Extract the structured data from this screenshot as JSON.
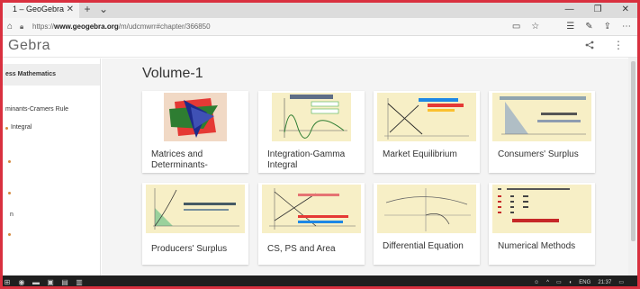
{
  "browser": {
    "tab": {
      "title": "1 – GeoGebra"
    },
    "url_prefix": "https://",
    "url_domain": "www.geogebra.org",
    "url_path": "/m/udcmwrr#chapter/366850"
  },
  "app": {
    "logo": "Gebra"
  },
  "sidebar": {
    "items": [
      {
        "label": "ess Mathematics"
      },
      {
        "label": "minants-Cramers Rule"
      },
      {
        "label": "Integral"
      },
      {
        "label": "n"
      }
    ]
  },
  "main": {
    "title": "Volume-1",
    "cards": [
      {
        "label": "Matrices and Determinants-"
      },
      {
        "label": "Integration-Gamma Integral"
      },
      {
        "label": "Market Equilibrium"
      },
      {
        "label": "Consumers' Surplus"
      },
      {
        "label": "Producers' Surplus"
      },
      {
        "label": "CS, PS and Area"
      },
      {
        "label": "Differential Equation"
      },
      {
        "label": "Numerical Methods"
      }
    ]
  },
  "taskbar": {
    "lang": "ENG",
    "time": "21:37"
  },
  "colors": {
    "frame": "#d9303f",
    "accent_orange": "#d58a3f",
    "thumb_bg": "#f7efc6"
  }
}
